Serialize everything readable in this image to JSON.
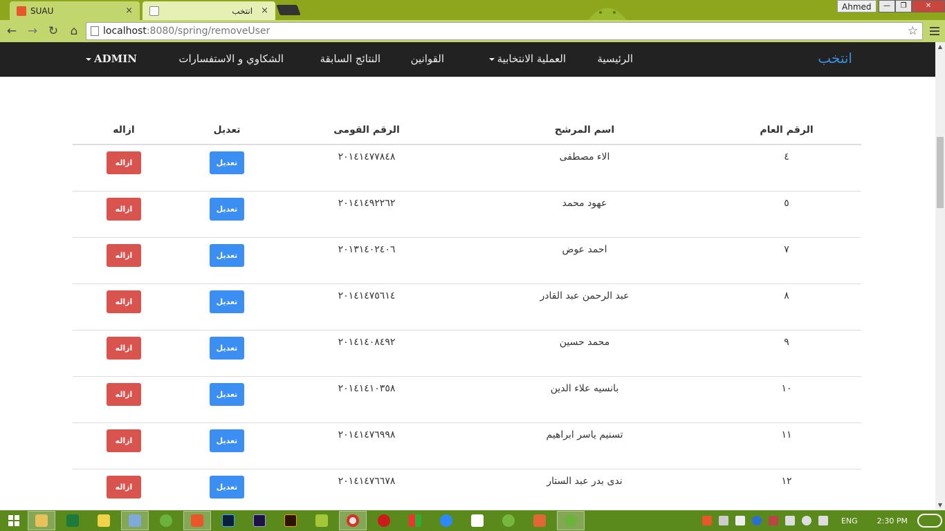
{
  "browser": {
    "tabs": [
      {
        "title": "SUAU",
        "close": "×"
      },
      {
        "title": "انتخب",
        "close": "×"
      }
    ],
    "profile_name": "Ahmed",
    "window_buttons": [
      "—",
      "❐",
      "✕"
    ],
    "url_host": "localhost",
    "url_rest": ":8080/spring/removeUser",
    "nav_icons": {
      "back": "←",
      "forward": "→",
      "reload": "↻",
      "home": "⌂",
      "star": "☆"
    }
  },
  "navbar": {
    "brand": "انتخب",
    "items": [
      "الرئيسية",
      "العملية الانتخابية",
      "القوانين",
      "النتائج السابقة",
      "الشكاوي و الاستفسارات",
      "ADMIN"
    ]
  },
  "table": {
    "headers": {
      "id": "الرقم العام",
      "name": "اسم المرشح",
      "national_id": "الرقم القومى",
      "edit": "تعديل",
      "remove": "ازاله"
    },
    "rows": [
      {
        "id": "٤",
        "name": "الاء مصطفى",
        "national_id": "٢٠١٤١٤٧٧٨٤٨",
        "edit": "تعديل",
        "remove": "ازاله"
      },
      {
        "id": "٥",
        "name": "عهود محمد",
        "national_id": "٢٠١٤١٤٩٢٢٦٢",
        "edit": "تعديل",
        "remove": "ازاله"
      },
      {
        "id": "٧",
        "name": "احمد عوض",
        "national_id": "٢٠١٣١٤٠٢٤٠٦",
        "edit": "تعديل",
        "remove": "ازاله"
      },
      {
        "id": "٨",
        "name": "عبد الرحمن عبد القادر",
        "national_id": "٢٠١٤١٤٧٥٦١٤",
        "edit": "تعديل",
        "remove": "ازاله"
      },
      {
        "id": "٩",
        "name": "محمد حسين",
        "national_id": "٢٠١٤١٤٠٨٤٩٢",
        "edit": "تعديل",
        "remove": "ازاله"
      },
      {
        "id": "١٠",
        "name": "بانسيه علاء الدين",
        "national_id": "٢٠١٤١٤١٠٣٥٨",
        "edit": "تعديل",
        "remove": "ازاله"
      },
      {
        "id": "١١",
        "name": "تسنيم ياسر ابراهيم",
        "national_id": "٢٠١٤١٤٧٦٩٩٨",
        "edit": "تعديل",
        "remove": "ازاله"
      },
      {
        "id": "١٢",
        "name": "ندى بدر عبد الستار",
        "national_id": "٢٠١٤١٤٧٦٦٧٨",
        "edit": "تعديل",
        "remove": "ازاله"
      }
    ]
  },
  "taskbar": {
    "language": "ENG",
    "time": "2:30 PM"
  },
  "colors": {
    "brand": "#3a8fd6",
    "edit_button": "#3b8ff2",
    "remove_button": "#d9534f",
    "navbar_bg": "#222222",
    "chrome_bg": "#8ea61b"
  }
}
